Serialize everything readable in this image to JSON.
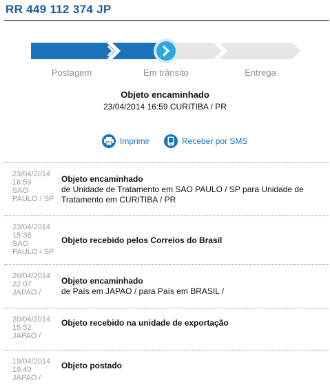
{
  "tracking_code": "RR 449 112 374 JP",
  "progress": {
    "steps": [
      "Postagem",
      "Em trânsito",
      "Entrega"
    ],
    "current_step": 2,
    "colors": {
      "done": "#1b73b8",
      "pending": "#e6e6e6",
      "current_circle": "#29a8e0"
    }
  },
  "status": {
    "title": "Objeto encaminhado",
    "datetime_location": "23/04/2014 16:59 CURITIBA / PR"
  },
  "actions": {
    "print_label": "Imprimir",
    "sms_label": "Receber por SMS"
  },
  "events": [
    {
      "date_lines": [
        "23/04/2014",
        "16:59",
        "SAO",
        "PAULO / SP"
      ],
      "title": "Objeto encaminhado",
      "detail_lines": [
        "de Unidade de Tratamento em SAO PAULO / SP para Unidade de",
        "Tratamento em CURITIBA / PR"
      ]
    },
    {
      "date_lines": [
        "23/04/2014",
        "15:38",
        "SAO",
        "PAULO / SP"
      ],
      "title": "Objeto recebido pelos Correios do Brasil",
      "detail_lines": []
    },
    {
      "date_lines": [
        "20/04/2014",
        "22:07",
        "JAPAO /"
      ],
      "title": "Objeto encaminhado",
      "detail_lines": [
        "de País em JAPAO / para País em BRASIL /"
      ]
    },
    {
      "date_lines": [
        "20/04/2014",
        "15:52",
        "JAPAO /"
      ],
      "title": "Objeto recebido na unidade de exportação",
      "detail_lines": []
    },
    {
      "date_lines": [
        "19/04/2014",
        "19:40",
        "JAPAO /"
      ],
      "title": "Objeto postado",
      "detail_lines": []
    }
  ]
}
